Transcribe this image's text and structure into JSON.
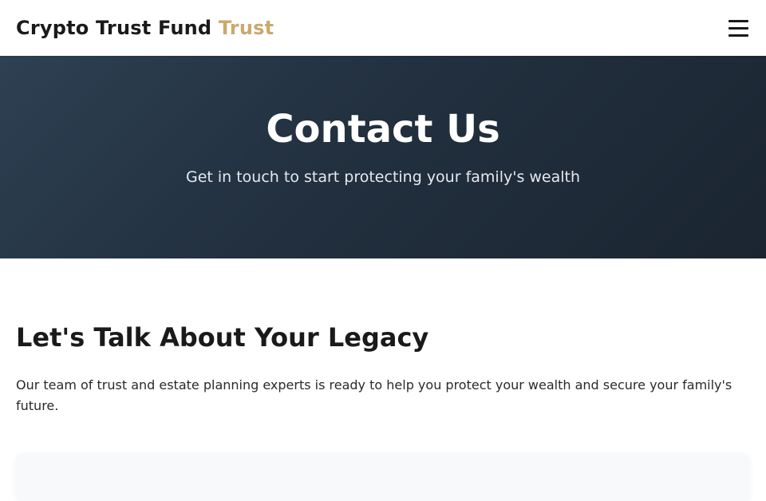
{
  "header": {
    "brand_main": "Crypto Trust Fund",
    "brand_accent": "Trust",
    "menu_icon": "hamburger-menu-icon"
  },
  "hero": {
    "title": "Contact Us",
    "subtitle": "Get in touch to start protecting your family's wealth"
  },
  "intro": {
    "heading": "Let's Talk About Your Legacy",
    "body": "Our team of trust and estate planning experts is ready to help you protect your wealth and secure your family's future."
  },
  "colors": {
    "accent": "#c9a96e",
    "hero_bg": "#22303f",
    "text": "#1a1a1a"
  }
}
